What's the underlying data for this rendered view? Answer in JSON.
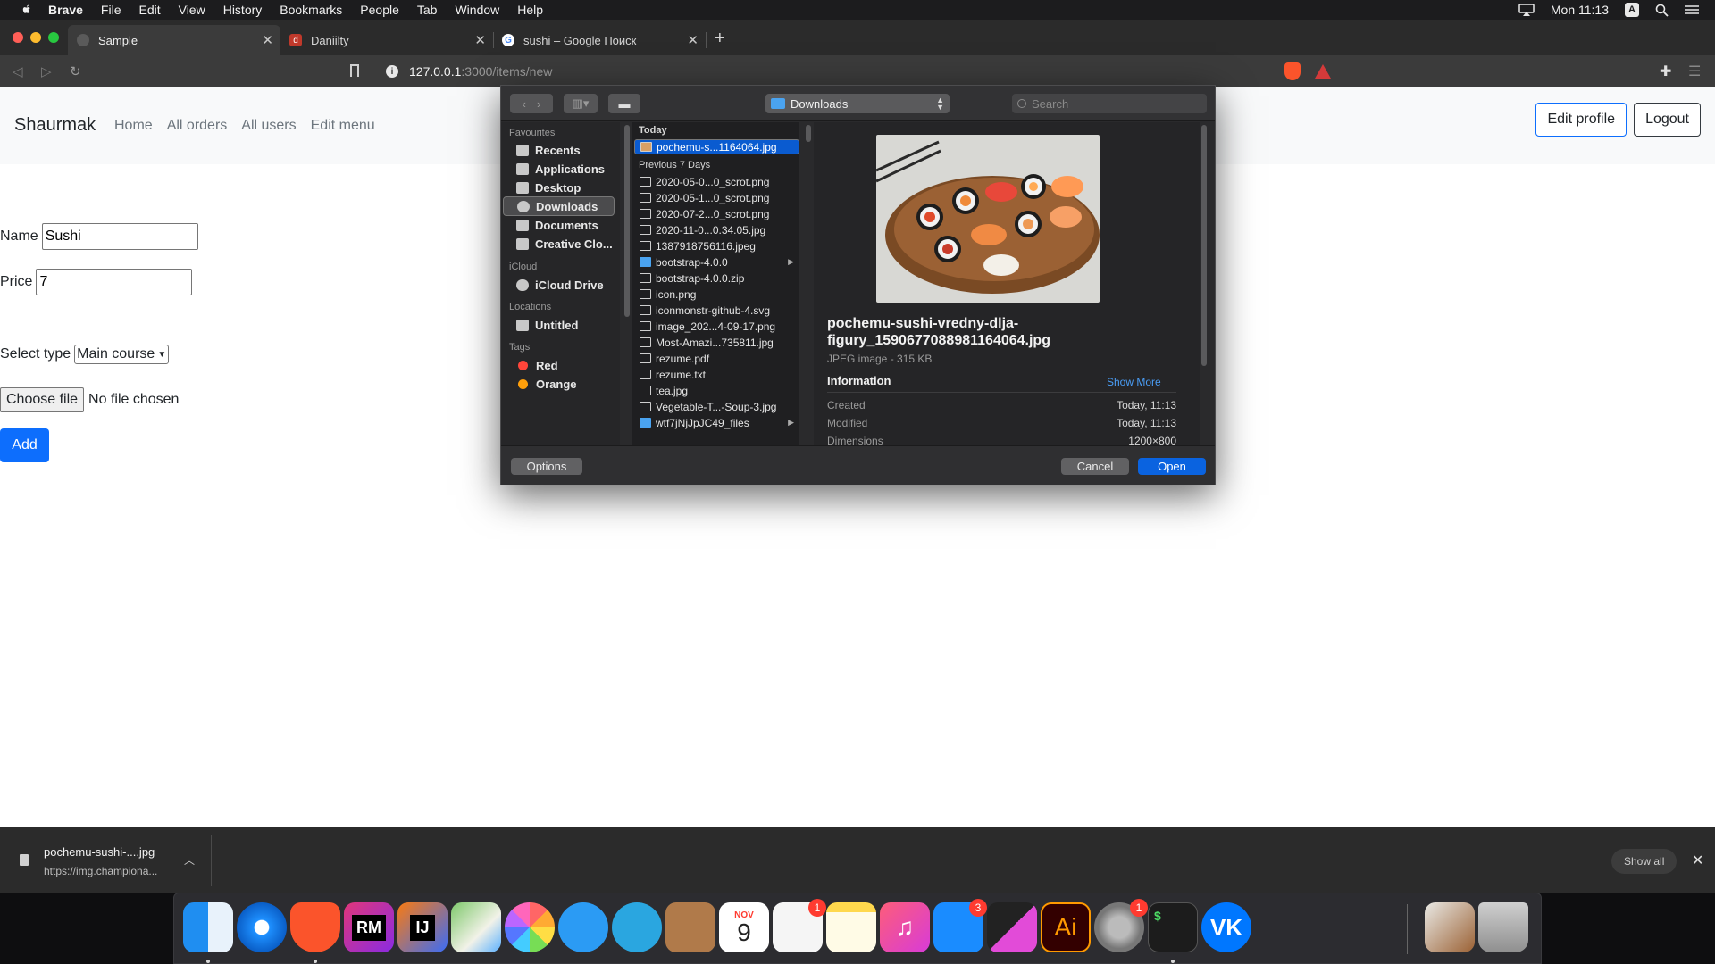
{
  "menubar": {
    "app": "Brave",
    "items": [
      "File",
      "Edit",
      "View",
      "History",
      "Bookmarks",
      "People",
      "Tab",
      "Window",
      "Help"
    ],
    "input_indicator": "A",
    "clock": "Mon 11:13"
  },
  "tabs": [
    {
      "title": "Sample",
      "favicon": "globe-icon"
    },
    {
      "title": "Daniilty",
      "favicon": "d"
    },
    {
      "title": "sushi – Google Поиск",
      "favicon": "google-icon"
    }
  ],
  "address": {
    "host": "127.0.0.1",
    "path": ":3000/items/new"
  },
  "navbar": {
    "brand": "Shaurmak",
    "links": [
      "Home",
      "All orders",
      "All users",
      "Edit menu"
    ],
    "edit_profile": "Edit profile",
    "logout": "Logout"
  },
  "form": {
    "name_label": "Name",
    "name_value": "Sushi",
    "price_label": "Price",
    "price_value": "7",
    "type_label": "Select type",
    "type_value": "Main course",
    "choose_file": "Choose file",
    "no_file": "No file chosen",
    "add": "Add"
  },
  "dialog": {
    "location": "Downloads",
    "search_placeholder": "Search",
    "sidebar": {
      "favourites_head": "Favourites",
      "favourites": [
        "Recents",
        "Applications",
        "Desktop",
        "Downloads",
        "Documents",
        "Creative Clo..."
      ],
      "icloud_head": "iCloud",
      "icloud": [
        "iCloud Drive"
      ],
      "locations_head": "Locations",
      "locations": [
        "Untitled"
      ],
      "tags_head": "Tags",
      "tags": [
        {
          "name": "Red",
          "color": "#ff453a"
        },
        {
          "name": "Orange",
          "color": "#ff9f0a"
        }
      ]
    },
    "files": {
      "today_head": "Today",
      "today": [
        "pochemu-s...1164064.jpg"
      ],
      "week_head": "Previous 7 Days",
      "week": [
        "2020-05-0...0_scrot.png",
        "2020-05-1...0_scrot.png",
        "2020-07-2...0_scrot.png",
        "2020-11-0...0.34.05.jpg",
        "1387918756116.jpeg",
        "bootstrap-4.0.0",
        "bootstrap-4.0.0.zip",
        "icon.png",
        "iconmonstr-github-4.svg",
        "image_202...4-09-17.png",
        "Most-Amazi...735811.jpg",
        "rezume.pdf",
        "rezume.txt",
        "tea.jpg",
        "Vegetable-T...-Soup-3.jpg",
        "wtf7jNjJpJC49_files"
      ]
    },
    "preview": {
      "filename": "pochemu-sushi-vredny-dlja-figury_1590677088981164064.jpg",
      "kind": "JPEG image - 315 KB",
      "info_head": "Information",
      "show_more": "Show More",
      "rows": [
        {
          "k": "Created",
          "v": "Today, 11:13"
        },
        {
          "k": "Modified",
          "v": "Today, 11:13"
        },
        {
          "k": "Dimensions",
          "v": "1200×800"
        }
      ]
    },
    "options": "Options",
    "cancel": "Cancel",
    "open": "Open"
  },
  "downloads": {
    "file": "pochemu-sushi-....jpg",
    "url": "https://img.championa...",
    "show_all": "Show all"
  },
  "dock": {
    "calendar_month": "NOV",
    "calendar_day": "9",
    "badges": {
      "reminders": "1",
      "appstore": "3",
      "settings": "1"
    },
    "rm_label": "RM",
    "ij_label": "IJ",
    "ai_label": "Ai",
    "terminal_label": "$"
  }
}
